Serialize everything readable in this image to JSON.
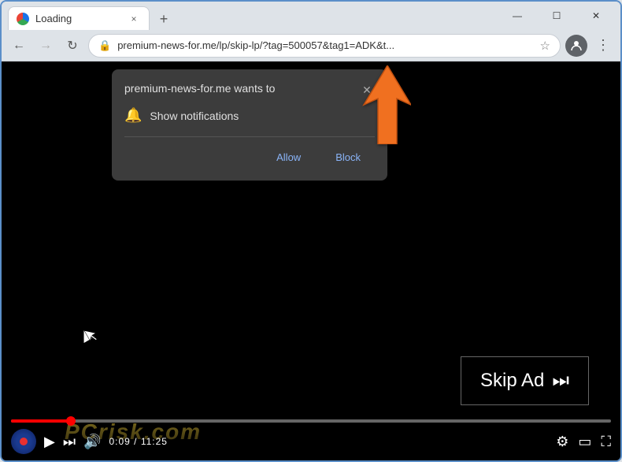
{
  "browser": {
    "tab": {
      "title": "Loading",
      "close_label": "×"
    },
    "new_tab_label": "+",
    "window_controls": {
      "minimize": "—",
      "maximize": "☐",
      "close": "✕"
    },
    "nav": {
      "back_label": "←",
      "forward_label": "→",
      "refresh_label": "↻",
      "url": "premium-news-for.me/lp/skip-lp/?tag=500057&tag1=ADK&t...",
      "star_label": "☆",
      "menu_label": "⋮"
    }
  },
  "notification_popup": {
    "site_name": "premium-news-for.me wants to",
    "close_label": "✕",
    "notification_text": "Show notifications",
    "allow_label": "Allow",
    "block_label": "Block"
  },
  "video": {
    "skip_ad_label": "Skip Ad",
    "skip_icon": "⏭",
    "time_current": "0:09",
    "time_total": "11:25",
    "watermark": "PCrisk.com",
    "controls": {
      "play_label": "▶",
      "next_label": "⏭",
      "volume_label": "🔊",
      "settings_label": "⚙",
      "theater_label": "▭",
      "fullscreen_label": "⛶"
    }
  },
  "colors": {
    "accent_orange": "#f07020",
    "progress_red": "#ff0000",
    "tab_bg": "#ffffff",
    "browser_bg": "#dee3e8",
    "popup_bg": "#3c3c3c",
    "video_bg": "#000000"
  }
}
